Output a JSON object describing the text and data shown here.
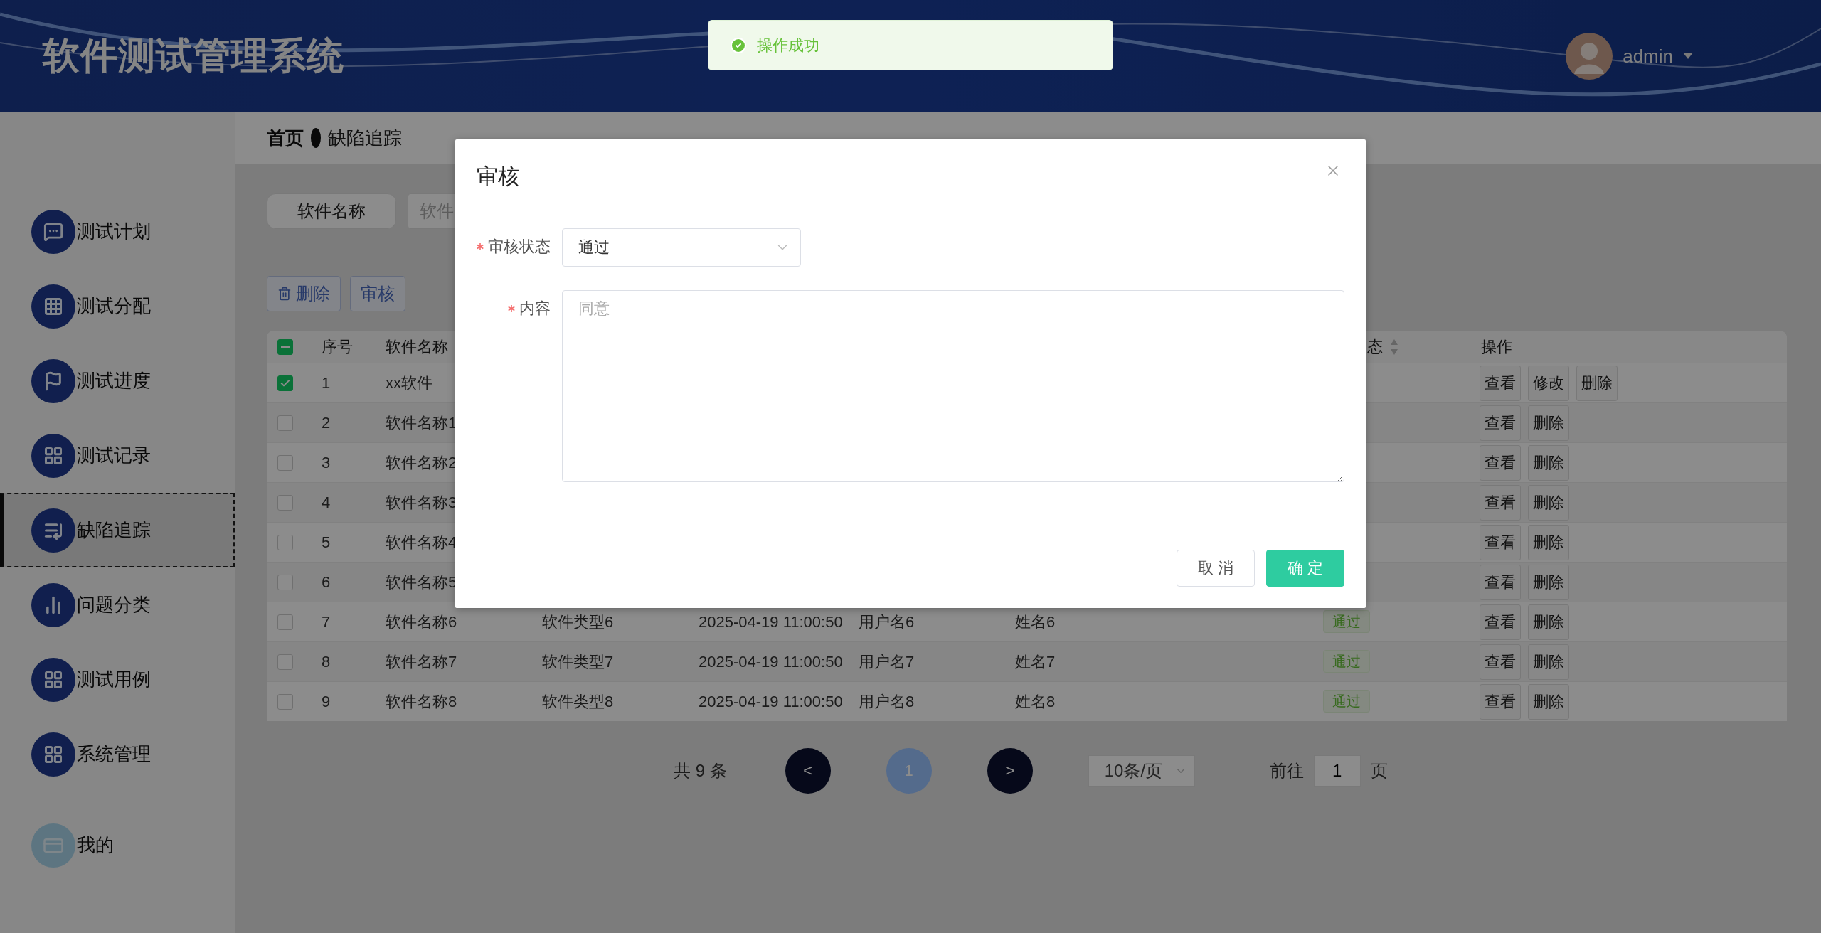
{
  "header": {
    "title": "软件测试管理系统",
    "user": "admin"
  },
  "toast": {
    "kind": "success",
    "message": "操作成功"
  },
  "sidebar": {
    "items": [
      {
        "label": "测试计划",
        "kind": "chat",
        "selected": false
      },
      {
        "label": "测试分配",
        "kind": "grid9",
        "selected": false
      },
      {
        "label": "测试进度",
        "kind": "flag",
        "selected": false
      },
      {
        "label": "测试记录",
        "kind": "grid4",
        "selected": false
      },
      {
        "label": "缺陷追踪",
        "kind": "list",
        "selected": true
      },
      {
        "label": "问题分类",
        "kind": "bars",
        "selected": false
      },
      {
        "label": "测试用例",
        "kind": "grid4",
        "selected": false
      },
      {
        "label": "系统管理",
        "kind": "grid4",
        "selected": false
      },
      {
        "label": "我的",
        "kind": "card",
        "selected": false
      }
    ]
  },
  "breadcrumb": [
    "首页",
    "缺陷追踪"
  ],
  "search": {
    "label": "软件名称",
    "placeholder": "软件"
  },
  "toolbar": [
    {
      "label": "删除",
      "kind": "delete"
    },
    {
      "label": "审核",
      "kind": "review"
    }
  ],
  "table": {
    "header_partial": true,
    "columns": {
      "index": "序号",
      "name": "软件名称",
      "status": "态",
      "actions": "操作"
    },
    "rows": [
      {
        "checked": true,
        "index": "1",
        "name": "xx软件",
        "actions": [
          "查看",
          "修改",
          "删除"
        ]
      },
      {
        "checked": false,
        "index": "2",
        "name": "软件名称1",
        "actions": [
          "查看",
          "删除"
        ]
      },
      {
        "checked": false,
        "index": "3",
        "name": "软件名称2",
        "actions": [
          "查看",
          "删除"
        ]
      },
      {
        "checked": false,
        "index": "4",
        "name": "软件名称3",
        "actions": [
          "查看",
          "删除"
        ]
      },
      {
        "checked": false,
        "index": "5",
        "name": "软件名称4",
        "actions": [
          "查看",
          "删除"
        ]
      },
      {
        "checked": false,
        "index": "6",
        "name": "软件名称5",
        "actions": [
          "查看",
          "删除"
        ]
      },
      {
        "checked": false,
        "index": "7",
        "name": "软件名称6",
        "type": "软件类型6",
        "time": "2025-04-19 11:00:50",
        "user": "用户名6",
        "realname": "姓名6",
        "status": {
          "label": "通过",
          "kind": "pass"
        },
        "actions": [
          "查看",
          "删除"
        ]
      },
      {
        "checked": false,
        "index": "8",
        "name": "软件名称7",
        "type": "软件类型7",
        "time": "2025-04-19 11:00:50",
        "user": "用户名7",
        "realname": "姓名7",
        "status": {
          "label": "通过",
          "kind": "pass"
        },
        "actions": [
          "查看",
          "删除"
        ]
      },
      {
        "checked": false,
        "index": "9",
        "name": "软件名称8",
        "type": "软件类型8",
        "time": "2025-04-19 11:00:50",
        "user": "用户名8",
        "realname": "姓名8",
        "status": {
          "label": "通过",
          "kind": "pass"
        },
        "actions": [
          "查看",
          "删除"
        ]
      }
    ]
  },
  "pagination": {
    "total": "共 9 条",
    "prev": "<",
    "pages": [
      {
        "label": "1",
        "selected": true
      }
    ],
    "next": ">",
    "page_size": "10条/页",
    "goto_label": "前往",
    "goto_value": "1",
    "goto_suffix": "页"
  },
  "dialog": {
    "title": "审核",
    "fields": [
      {
        "kind": "select",
        "label": "审核状态",
        "required": true,
        "value": "通过"
      },
      {
        "kind": "textarea",
        "label": "内容",
        "required": true,
        "placeholder": "同意"
      }
    ],
    "buttons": [
      {
        "label": "取 消",
        "kind": "default"
      },
      {
        "label": "确 定",
        "kind": "primary"
      }
    ]
  }
}
